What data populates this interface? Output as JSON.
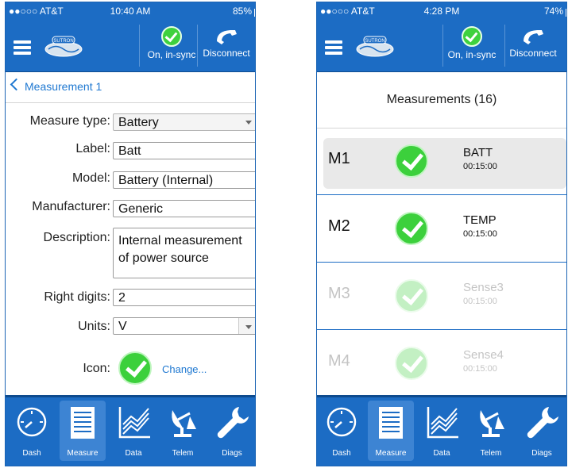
{
  "left_screen": {
    "status": {
      "carrier": "●●○○○ AT&T",
      "time": "10:40 AM",
      "battery": "85%"
    },
    "sync_label": "On, in-sync",
    "disconnect_label": "Disconnect",
    "back_label": "Measurement 1",
    "form": {
      "measure_type_label": "Measure type:",
      "measure_type_value": "Battery",
      "label_label": "Label:",
      "label_value": "Batt",
      "model_label": "Model:",
      "model_value": "Battery (Internal)",
      "manufacturer_label": "Manufacturer:",
      "manufacturer_value": "Generic",
      "description_label": "Description:",
      "description_value": "Internal measurement of power source",
      "right_digits_label": "Right digits:",
      "right_digits_value": "2",
      "units_label": "Units:",
      "units_value": "V",
      "icon_label": "Icon:",
      "change_label": "Change..."
    }
  },
  "right_screen": {
    "status": {
      "carrier": "●●○○○ AT&T",
      "time": "4:28 PM",
      "battery": "74%"
    },
    "sync_label": "On, in-sync",
    "disconnect_label": "Disconnect",
    "header": "Measurements (16)",
    "items": [
      {
        "code": "M1",
        "name": "BATT",
        "interval": "00:15:00"
      },
      {
        "code": "M2",
        "name": "TEMP",
        "interval": "00:15:00"
      },
      {
        "code": "M3",
        "name": "Sense3",
        "interval": "00:15:00"
      },
      {
        "code": "M4",
        "name": "Sense4",
        "interval": "00:15:00"
      }
    ]
  },
  "tabs": [
    {
      "label": "Dash",
      "icon": "gauge-icon"
    },
    {
      "label": "Measure",
      "icon": "list-icon"
    },
    {
      "label": "Data",
      "icon": "chart-icon"
    },
    {
      "label": "Telem",
      "icon": "satellite-dish-icon"
    },
    {
      "label": "Diags",
      "icon": "wrench-icon"
    }
  ],
  "colors": {
    "nav_blue": "#1c6cc4",
    "link_blue": "#1f78d1",
    "check_green": "#3cd03c"
  }
}
